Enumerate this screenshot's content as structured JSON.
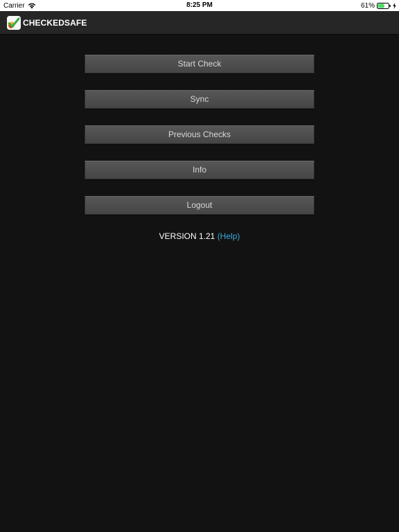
{
  "status_bar": {
    "carrier": "Carrier",
    "time": "8:25 PM",
    "battery_percent": "61%",
    "battery_level": 0.61,
    "battery_color": "#4cd964",
    "icons": [
      "wifi-icon",
      "battery-icon",
      "charging-icon"
    ]
  },
  "nav": {
    "title": "CHECKEDSAFE",
    "logo_icon": "checkmark-logo-icon"
  },
  "menu": {
    "items": [
      {
        "label": "Start Check"
      },
      {
        "label": "Sync"
      },
      {
        "label": "Previous Checks"
      },
      {
        "label": "Info"
      },
      {
        "label": "Logout"
      }
    ]
  },
  "footer": {
    "version": "VERSION 1.21",
    "help": "(Help)",
    "help_color": "#3aa8dc"
  }
}
